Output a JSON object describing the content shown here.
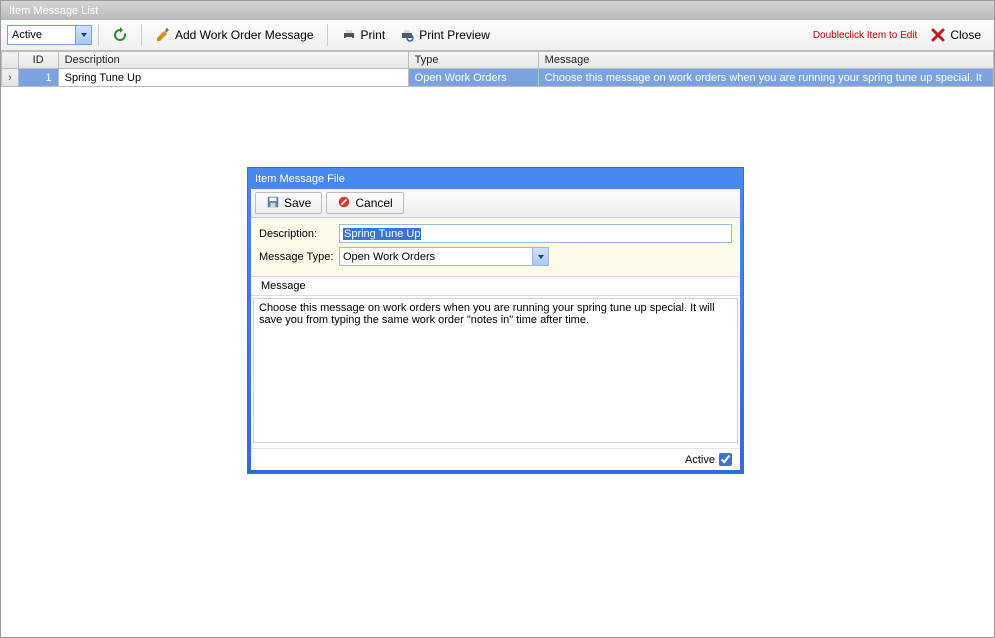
{
  "main": {
    "title": "Item Message List",
    "hint": "Doubleclick Item to Edit"
  },
  "toolbar": {
    "active_filter": "Active",
    "add_label": "Add Work Order Message",
    "print_label": "Print",
    "preview_label": "Print Preview",
    "close_label": "Close"
  },
  "grid": {
    "headers": {
      "id": "ID",
      "description": "Description",
      "type": "Type",
      "message": "Message"
    },
    "row": {
      "id": "1",
      "description": "Spring Tune Up",
      "type": "Open Work Orders",
      "message": "Choose this message on work orders when you are running your spring tune up special. It"
    }
  },
  "dialog": {
    "title": "Item Message File",
    "save_label": "Save",
    "cancel_label": "Cancel",
    "desc_label": "Description:",
    "desc_value": "Spring Tune Up",
    "type_label": "Message Type:",
    "type_value": "Open Work Orders",
    "msg_section_label": "Message",
    "msg_value": "Choose this message on work orders when you are running your spring tune up special. It will save you from typing the same work order \"notes in\" time after time.",
    "active_label": "Active"
  }
}
